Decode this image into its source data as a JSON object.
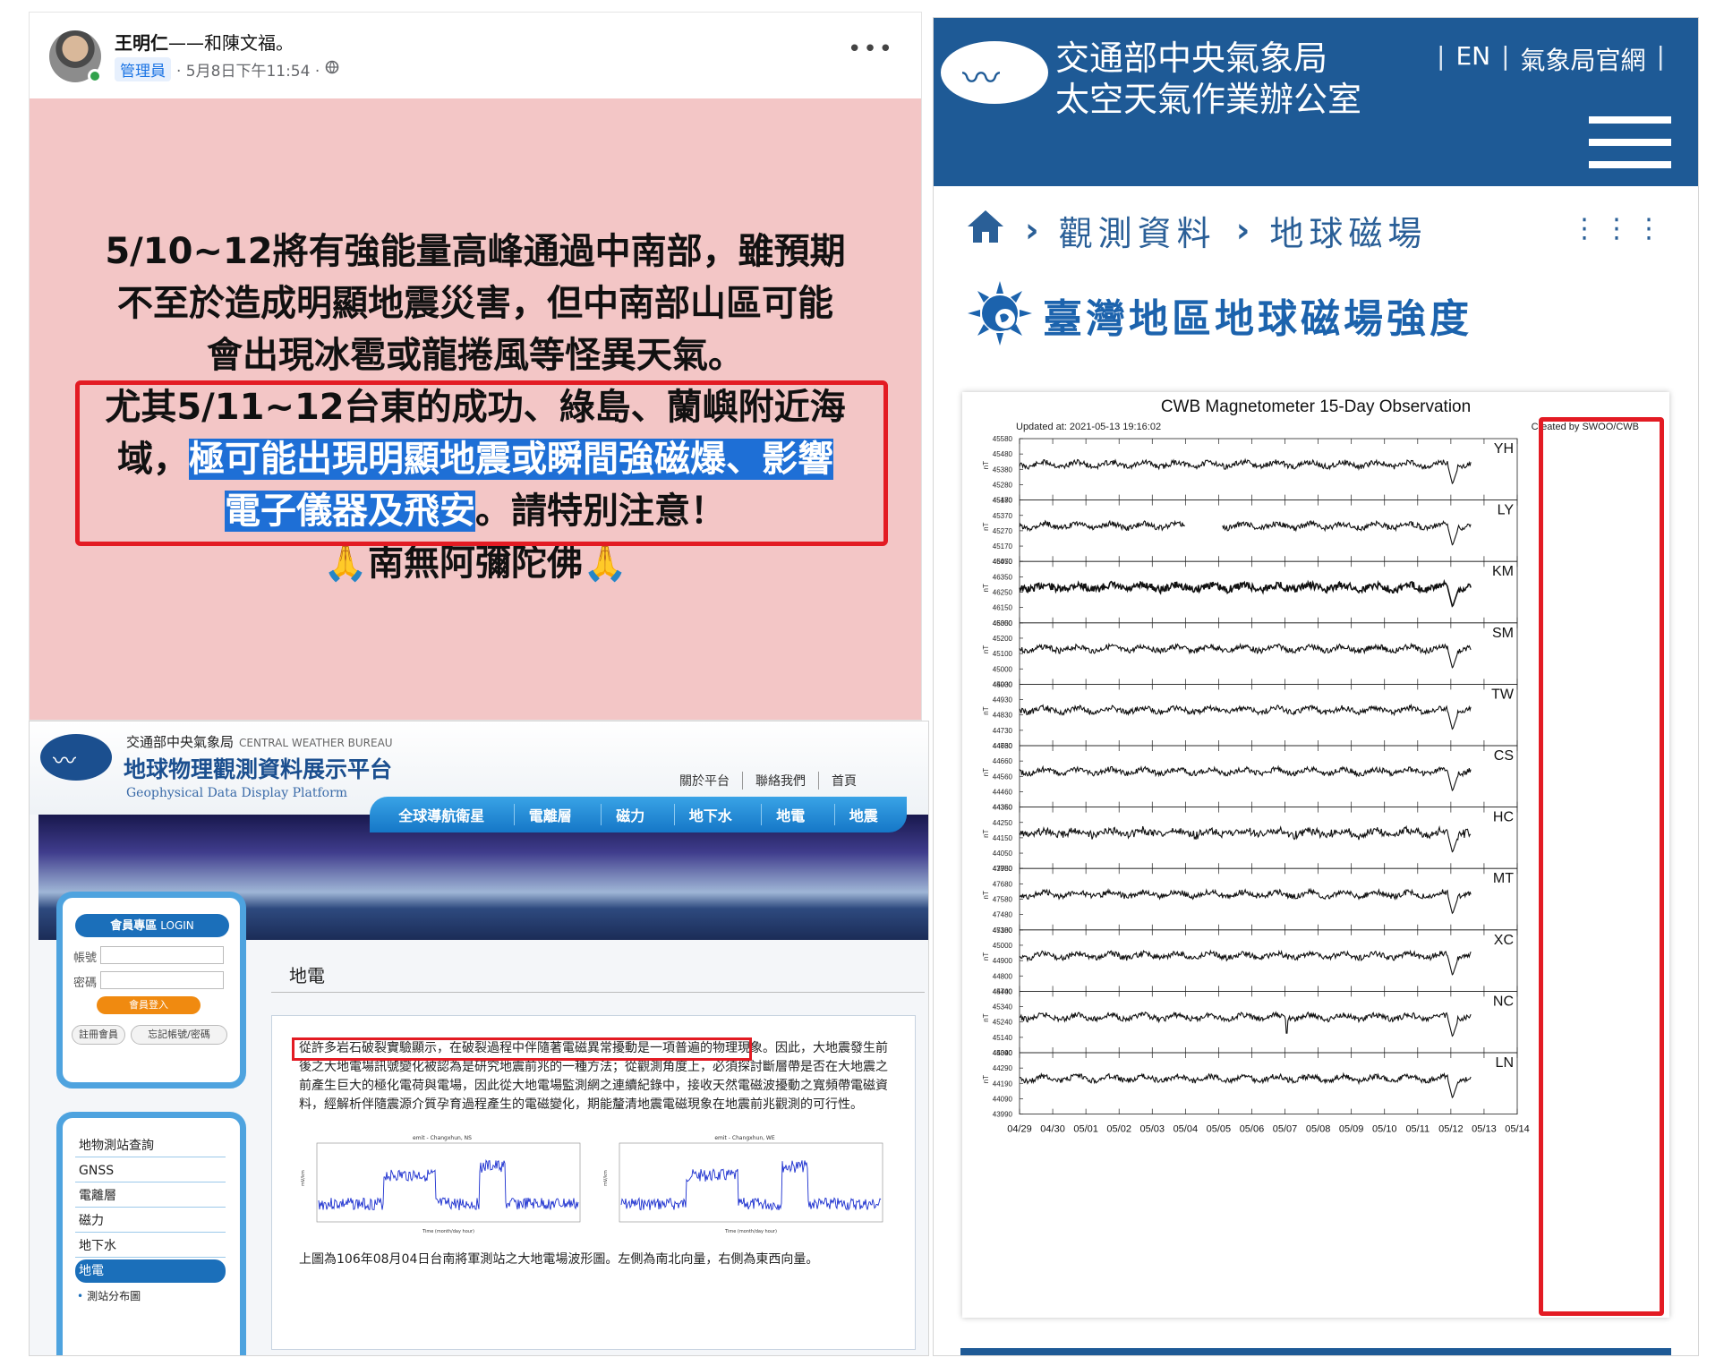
{
  "facebook_post": {
    "author": "王明仁",
    "with_text": "——和陳文福。",
    "role_badge": "管理員",
    "timestamp": "· 5月8日下午11:54 ·",
    "privacy_icon": "globe-icon",
    "more_icon": "more-horizontal-icon",
    "line1": "5/10~12將有強能量高峰通過中南部，雖預期",
    "line2": "不至於造成明顯地震災害，但中南部山區可能",
    "line3": "會出現冰雹或龍捲風等怪異天氣。",
    "line4": "尤其5/11~12台東的成功、綠島、蘭嶼附近海",
    "line5_plain": "域，",
    "line5_highlight": "極可能出現明顯地震或瞬間強磁爆、影響",
    "line6_highlight": "電子儀器及飛安",
    "line6_plain": "。請特別注意！",
    "line7": "🙏南無阿彌陀佛🙏",
    "background_color": "#f3c6c6",
    "highlight_color": "#1e6fd6"
  },
  "geo_platform": {
    "bureau_name": "交通部中央氣象局",
    "bureau_name_en": "CENTRAL WEATHER BUREAU",
    "title": "地球物理觀測資料展示平台",
    "subtitle": "Geophysical Data Display Platform",
    "top_links": [
      "關於平台",
      "聯絡我們",
      "首頁"
    ],
    "nav_tabs": [
      "全球導航衛星",
      "電離層",
      "磁力",
      "地下水",
      "地電",
      "地震"
    ],
    "login_title": "會員專區",
    "login_title_en": "LOGIN",
    "account_label": "帳號",
    "password_label": "密碼",
    "login_button": "會員登入",
    "register_button": "註冊會員",
    "forgot_button": "忘記帳號/密碼",
    "menu_items": [
      "地物測站查詢",
      "GNSS",
      "電離層",
      "磁力",
      "地下水",
      "地電"
    ],
    "active_menu": "地電",
    "submenu_item": "測站分布圖",
    "content_title": "地電",
    "paragraph_highlight": "從許多岩石破裂實驗顯示，在破裂過程中伴隨著電磁異常擾動是一項普遍的物理現象。",
    "paragraph_rest": "因此，大地震發生前後之大地電場訊號變化被認為是研究地震前兆的一種方法；從觀測角度上，必須探討斷層帶是否在大地震之前產生巨大的極化電荷與電場，因此從大地電場監測網之連續紀錄中，接收天然電磁波擾動之寬頻帶電磁資料，經解析伴隨震源介質孕育過程產生的電磁變化，期能釐清地震電磁現象在地震前兆觀測的可行性。",
    "plot_left_title": "emit - Changxhun, NS",
    "plot_right_title": "emit - Changxhun, WE",
    "plot_ylabel": "mV/km",
    "plot_xlabel": "Time (month/day hour)",
    "caption": "上圖為106年08月04日台南將軍測站之大地電場波形圖。左側為南北向量，右側為東西向量。"
  },
  "cwb": {
    "title_line1": "交通部中央氣象局",
    "title_line2": "太空天氣作業辦公室",
    "lang_link": "EN",
    "official_link": "氣象局官網",
    "menu_icon": "hamburger-menu-icon",
    "home_icon": "home-icon",
    "breadcrumb": [
      "觀測資料",
      "地球磁場"
    ],
    "more_icon": "dots-grid-icon",
    "page_title": "臺灣地區地球磁場強度",
    "title_icon": "sun-earth-icon"
  },
  "chart_data": {
    "type": "line",
    "title": "CWB Magnetometer 15-Day Observation",
    "updated": "Updated at: 2021-05-13 19:16:02",
    "created_by": "Created by SWOO/CWB",
    "ylabel": "nT",
    "x_ticks": [
      "04/29",
      "04/30",
      "05/01",
      "05/02",
      "05/03",
      "05/04",
      "05/05",
      "05/06",
      "05/07",
      "05/08",
      "05/09",
      "05/10",
      "05/11",
      "05/12",
      "05/13",
      "05/14"
    ],
    "stations": [
      {
        "name": "YH",
        "y_ticks": [
          45580,
          45480,
          45380,
          45280,
          45180
        ],
        "gap": null,
        "dip": null
      },
      {
        "name": "LY",
        "y_ticks": [
          45470,
          45370,
          45270,
          45170,
          45070
        ],
        "gap": [
          5.0,
          6.1
        ],
        "dip": null
      },
      {
        "name": "KM",
        "y_ticks": [
          46450,
          46350,
          46250,
          46150,
          46050
        ],
        "gap": null,
        "dip": null
      },
      {
        "name": "SM",
        "y_ticks": [
          45300,
          45200,
          45100,
          45000,
          44900
        ],
        "gap": null,
        "dip": null
      },
      {
        "name": "TW",
        "y_ticks": [
          45030,
          44930,
          44830,
          44730,
          44630
        ],
        "gap": null,
        "dip": null
      },
      {
        "name": "CS",
        "y_ticks": [
          44760,
          44660,
          44560,
          44460,
          44360
        ],
        "gap": null,
        "dip": null
      },
      {
        "name": "HC",
        "y_ticks": [
          44350,
          44250,
          44150,
          44050,
          43950
        ],
        "gap": null,
        "dip": null
      },
      {
        "name": "MT",
        "y_ticks": [
          47780,
          47680,
          47580,
          47480,
          47380
        ],
        "gap": null,
        "dip": null
      },
      {
        "name": "XC",
        "y_ticks": [
          45100,
          45000,
          44900,
          44800,
          44700
        ],
        "gap": null,
        "dip": null
      },
      {
        "name": "NC",
        "y_ticks": [
          45440,
          45340,
          45240,
          45140,
          45040
        ],
        "gap": null,
        "dip": 8.05
      },
      {
        "name": "LN",
        "y_ticks": [
          44390,
          44290,
          44190,
          44090,
          43990
        ],
        "gap": null,
        "dip": null
      }
    ],
    "highlight_range": [
      "05/12",
      "05/14"
    ],
    "highlight_color": "#e31b23"
  }
}
